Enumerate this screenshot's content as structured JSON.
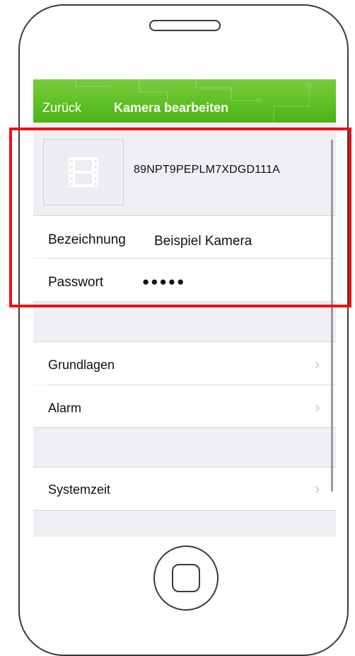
{
  "nav": {
    "back_label": "Zurück",
    "title": "Kamera bearbeiten"
  },
  "camera": {
    "id": "89NPT9PEPLM7XDGD111A",
    "thumbnail_icon": "film-icon"
  },
  "fields": {
    "name_label": "Bezeichnung",
    "name_value": "Beispiel Kamera",
    "password_label": "Passwort",
    "password_value": "●●●●●"
  },
  "menu": {
    "items": [
      {
        "label": "Grundlagen"
      },
      {
        "label": "Alarm"
      },
      {
        "label": "Systemzeit"
      }
    ],
    "chevron": "›"
  },
  "colors": {
    "nav_green": "#5cbf24",
    "highlight_red": "#ee1111",
    "screen_bg": "#efeff4"
  }
}
